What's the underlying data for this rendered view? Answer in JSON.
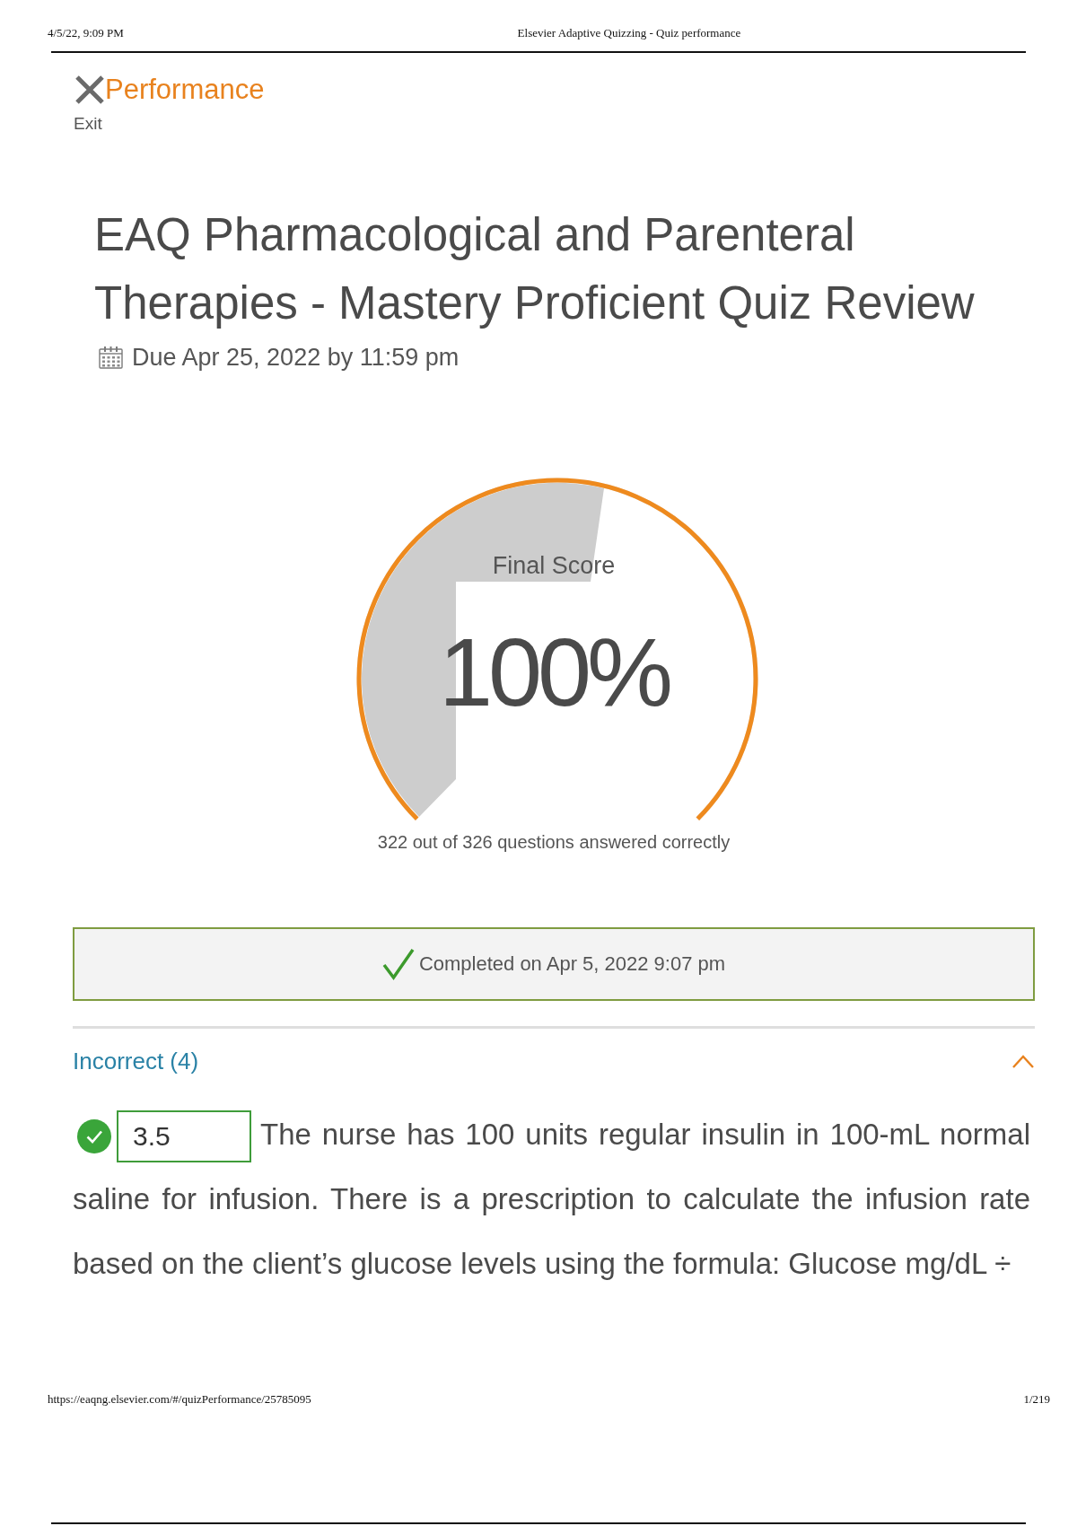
{
  "print_header": {
    "date": "4/5/22, 9:09 PM",
    "title": "Elsevier Adaptive Quizzing - Quiz performance"
  },
  "top_bar": {
    "title": "Performance",
    "exit_label": "Exit"
  },
  "quiz": {
    "title": "EAQ Pharmacological and Parenteral Therapies - Mastery Proficient Quiz Review",
    "due": "Due Apr 25, 2022 by 11:59 pm"
  },
  "score_gauge": {
    "label": "Final Score",
    "score": "100%",
    "level": 1,
    "summary": "322 out of 326 questions answered correctly"
  },
  "completion": {
    "text": "Completed on Apr 5, 2022 9:07 pm"
  },
  "incorrect_section": {
    "heading": "Incorrect (4)",
    "expanded": true,
    "questions": [
      {
        "correct": true,
        "answer": "3.5",
        "text": "The nurse has 100 units regular insulin in 100-mL normal saline for infusion. There is a prescription to calculate the infusion rate based on the client’s glucose levels using the formula: Glucose mg/dL ÷"
      }
    ]
  },
  "print_footer": {
    "url": "https://eaqng.elsevier.com/#/quizPerformance/25785095",
    "page": "1/219"
  }
}
